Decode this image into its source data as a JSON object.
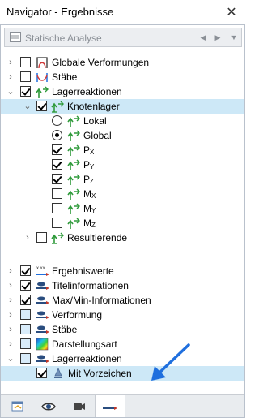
{
  "window": {
    "title": "Navigator - Ergebnisse",
    "close_symbol": "✕"
  },
  "combo": {
    "value": "Statische Analyse",
    "prev_symbol": "◀",
    "next_symbol": "▶",
    "dropdown_symbol": "▼"
  },
  "tree1": {
    "globale_verformungen": "Globale Verformungen",
    "staebe": "Stäbe",
    "lagerreaktionen": "Lagerreaktionen",
    "knotenlager": "Knotenlager",
    "lokal": "Lokal",
    "global": "Global",
    "px": "P",
    "px_sub": "X",
    "py": "P",
    "py_sub": "Y",
    "pz": "P",
    "pz_sub": "Z",
    "mx": "M",
    "mx_sub": "X",
    "my": "M",
    "my_sub": "Y",
    "mz": "M",
    "mz_sub": "Z",
    "resultierende": "Resultierende"
  },
  "tree2": {
    "ergebniswerte": "Ergebniswerte",
    "titelinformationen": "Titelinformationen",
    "maxmin": "Max/Min-Informationen",
    "verformung": "Verformung",
    "staebe": "Stäbe",
    "darstellungsart": "Darstellungsart",
    "lagerreaktionen": "Lagerreaktionen",
    "mit_vorzeichen": "Mit Vorzeichen"
  },
  "icons": {
    "expand_collapsed": "›",
    "expand_expanded": "⌄",
    "accent_blue": "#1f6fde",
    "support_green": "#2e9a3a",
    "selected_row": "#cde8f7"
  }
}
